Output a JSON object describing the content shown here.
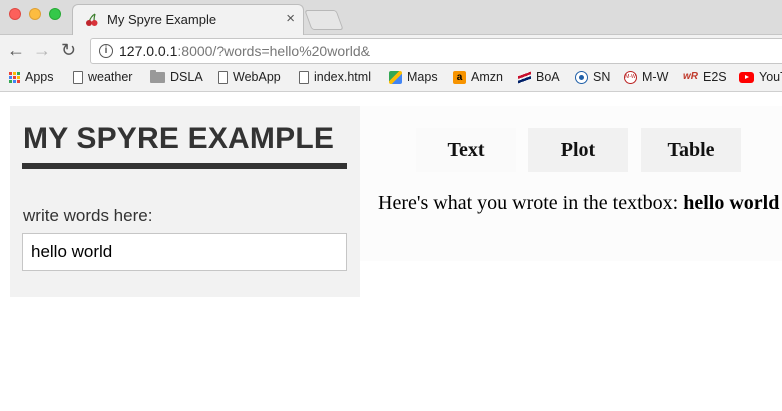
{
  "browser": {
    "tab_title": "My Spyre Example",
    "tab_close": "×",
    "url_host": "127.0.0.1",
    "url_rest": ":8000/?words=hello%20world&",
    "nav": {
      "back": "←",
      "forward": "→",
      "reload": "↻"
    },
    "info_icon": "i",
    "bookmarks": [
      {
        "label": "Apps",
        "icon": "apps-grid-icon"
      },
      {
        "label": "weather",
        "icon": "page-icon"
      },
      {
        "label": "DSLA",
        "icon": "folder-icon"
      },
      {
        "label": "WebApp",
        "icon": "page-icon"
      },
      {
        "label": "index.html",
        "icon": "page-icon"
      },
      {
        "label": "Maps",
        "icon": "maps-icon"
      },
      {
        "label": "Amzn",
        "icon": "amazon-icon",
        "glyph": "a"
      },
      {
        "label": "BoA",
        "icon": "boa-icon"
      },
      {
        "label": "SN",
        "icon": "sn-icon"
      },
      {
        "label": "M-W",
        "icon": "mw-icon",
        "glyph": "M-W"
      },
      {
        "label": "E2S",
        "icon": "e2s-icon",
        "glyph": "wR"
      },
      {
        "label": "YouTube",
        "icon": "youtube-icon"
      }
    ]
  },
  "app": {
    "title": "MY SPYRE EXAMPLE",
    "input_label": "write words here:",
    "input_value": "hello world",
    "tabs": [
      "Text",
      "Plot",
      "Table"
    ],
    "selected_tab": "Text",
    "output_prefix": "Here's what you wrote in the textbox: ",
    "output_value": "hello world"
  },
  "colors": {
    "sidebar_bg": "#f2f2f2",
    "title_color": "#333333",
    "tab_bg": "#f1f1f1"
  }
}
